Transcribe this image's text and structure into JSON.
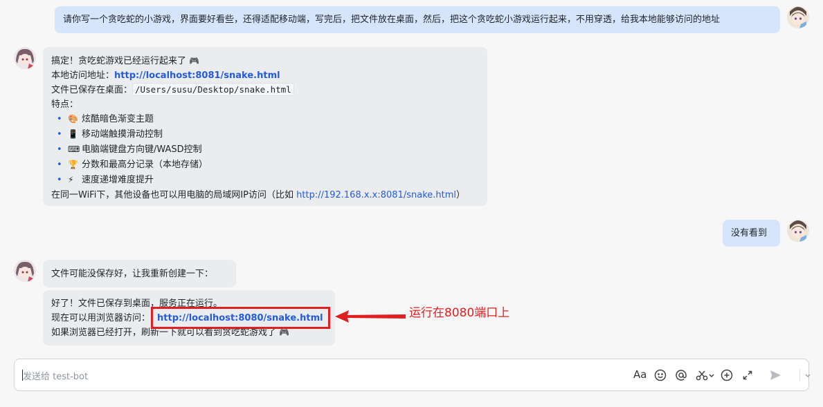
{
  "messages": {
    "user1": {
      "text": "请你写一个贪吃蛇的小游戏，界面要好看些，还得适配移动端，写完后，把文件放在桌面，然后，把这个贪吃蛇小游戏运行起来，不用穿透，给我本地能够访问的地址"
    },
    "bot1": {
      "line1": "搞定！贪吃蛇游戏已经运行起来了",
      "line1_emoji": "🎮",
      "access_label": "本地访问地址：",
      "access_url": "http://localhost:8081/snake.html",
      "saved_label": "文件已保存在桌面：",
      "saved_path": "/Users/susu/Desktop/snake.html",
      "features_label": "特点：",
      "features": [
        {
          "emoji": "🎨",
          "text": "炫酷暗色渐变主题"
        },
        {
          "emoji": "📱",
          "text": "移动端触摸滑动控制"
        },
        {
          "emoji": "⌨",
          "text": "电脑端键盘方向键/WASD控制"
        },
        {
          "emoji": "🏆",
          "text": "分数和最高分记录（本地存储）"
        },
        {
          "emoji": "⚡",
          "text": "速度递增难度提升"
        }
      ],
      "wifi_prefix": "在同一WiFi下，其他设备也可以用电脑的局域网IP访问（比如 ",
      "wifi_url": "http://192.168.x.x:8081/snake.html",
      "wifi_suffix": "）"
    },
    "user2": {
      "text": "没有看到"
    },
    "bot2": {
      "text": "文件可能没保存好，让我重新创建一下："
    },
    "bot3": {
      "line1": "好了！文件已保存到桌面，服务正在运行。",
      "line2_label": "现在可以用浏览器访问：",
      "line2_url": "http://localhost:8080/snake.html",
      "line3": "如果浏览器已经打开，刷新一下就可以看到贪吃蛇游戏了",
      "line3_emoji": "🎮"
    }
  },
  "annotation": {
    "text": "运行在8080端口上",
    "color": "#e02020"
  },
  "composer": {
    "placeholder": "发送给 test-bot",
    "tools": {
      "format": "Aa",
      "icons": [
        "emoji-icon",
        "mention-icon",
        "scissors-icon",
        "plus-circle-icon",
        "expand-icon",
        "send-icon",
        "chevron-down-icon"
      ]
    }
  },
  "colors": {
    "user_bubble": "#d6e4fc",
    "bot_bubble": "#ebecee",
    "link": "#245bdb",
    "accent_red": "#e02020"
  }
}
